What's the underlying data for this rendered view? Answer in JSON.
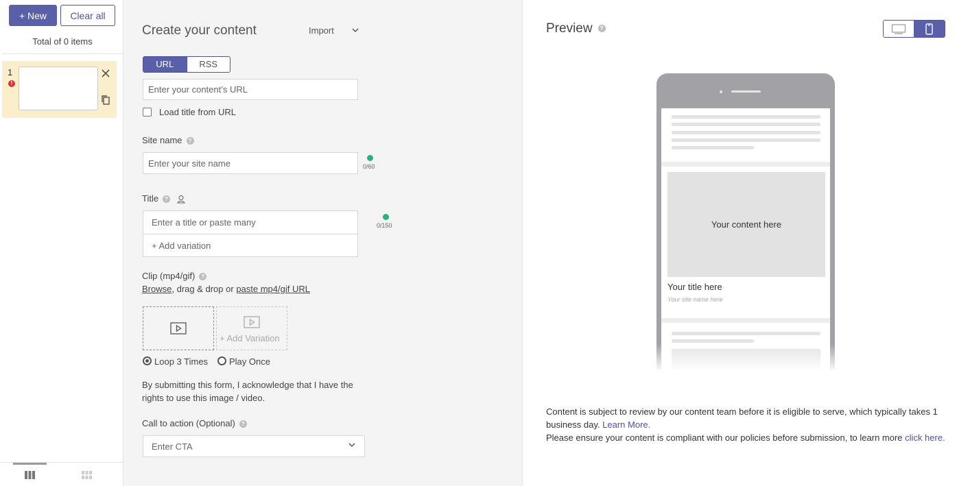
{
  "sidebar": {
    "new_label": "+ New",
    "clear_label": "Clear all",
    "total_text": "Total of 0 items",
    "items": [
      {
        "number": "1",
        "warning": "!"
      }
    ]
  },
  "form": {
    "heading": "Create your content",
    "import_label": "Import",
    "source_tabs": [
      "URL",
      "RSS"
    ],
    "url_placeholder": "Enter your content’s URL",
    "load_title_label": "Load title from URL",
    "site_name_label": "Site name",
    "site_name_placeholder": "Enter your site name",
    "site_name_count": "0/60",
    "title_label": "Title",
    "title_placeholder": "Enter a title or paste many",
    "add_variation": "+ Add variation",
    "title_count": "0/150",
    "clip_label": "Clip (mp4/gif)",
    "clip_browse": "Browse",
    "clip_middle": ", drag & drop or ",
    "clip_paste": "paste mp4/gif URL",
    "clip_add_variation": "+ Add Variation",
    "loop_label": "Loop 3 Times",
    "play_once_label": "Play Once",
    "acknowledge": "By submitting this form, I acknowledge that I have the rights to use this image / video.",
    "cta_label": "Call to action (Optional)",
    "cta_placeholder": "Enter CTA",
    "help_glyph": "?"
  },
  "preview": {
    "title": "Preview",
    "content_placeholder": "Your content here",
    "title_placeholder": "Your title here",
    "site_placeholder": "Your site name here",
    "notice_line1": "Content is subject to review by our content team before it is eligible to serve, which typically takes 1 business day.",
    "learn_more": "Learn More.",
    "notice_line2": "Please ensure your content is compliant with our policies before submission, to learn more",
    "click_here": "click here."
  },
  "colors": {
    "accent": "#5a5fa9",
    "warning_bg": "#fbeecb",
    "success": "#2ab27b",
    "error": "#dd3333"
  },
  "icons": [
    "close-icon",
    "copy-icon",
    "list-view-icon",
    "grid-view-icon",
    "chevron-down-icon",
    "help-icon",
    "person-pin-icon",
    "video-icon",
    "check-circle-icon",
    "desktop-icon",
    "mobile-icon"
  ]
}
